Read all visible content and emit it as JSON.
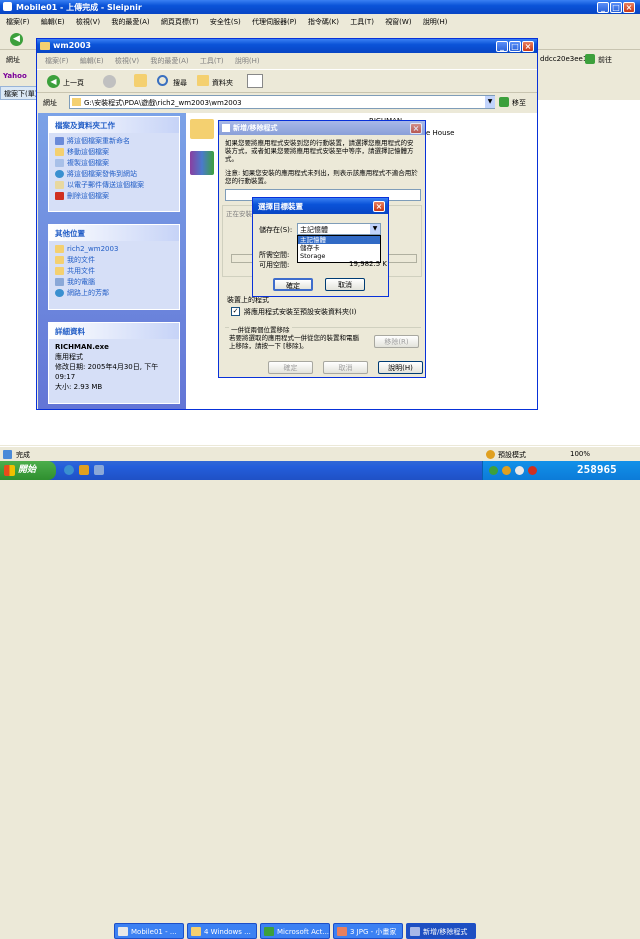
{
  "browser": {
    "title": "Mobile01 - 上傳完成 - Sleipnir",
    "menu": [
      "檔案(F)",
      "編輯(E)",
      "檢視(V)",
      "我的最愛(A)",
      "網頁頁標(T)",
      "安全性(S)",
      "代理伺服器(P)",
      "指令碼(K)",
      "工具(T)",
      "視窗(W)",
      "說明(H)"
    ],
    "url_fragment": "ddcc20e3ee17",
    "go_label": "前往",
    "address_label": "網址",
    "fav_label": "Yahoo",
    "status_text": "完成",
    "status_mode": "預設模式",
    "zoom": "100%",
    "tab_label": "檔案下(單)"
  },
  "explorer": {
    "title": "wm2003",
    "menu": [
      "檔案(F)",
      "編輯(E)",
      "檢視(V)",
      "我的最愛(A)",
      "工具(T)",
      "說明(H)"
    ],
    "back_label": "上一頁",
    "search_label": "搜尋",
    "folders_label": "資料夾",
    "address_label": "網址",
    "address": "G:\\安裝程式\\PDA\\遊戲\\rich2_wm2003\\wm2003",
    "go_label": "移至",
    "file_tasks": {
      "title": "檔案及資料夾工作",
      "items": [
        "將這個檔案重新命名",
        "移動這個檔案",
        "複製這個檔案",
        "將這個檔案發佈到網站",
        "以電子郵件傳送這個檔案",
        "刪除這個檔案"
      ]
    },
    "other_places": {
      "title": "其他位置",
      "items": [
        "rich2_wm2003",
        "我的文件",
        "共用文件",
        "我的電腦",
        "網路上的芳鄰"
      ]
    },
    "details": {
      "title": "詳細資料",
      "name": "RICHMAN.exe",
      "type": "應用程式",
      "modified": "修改日期: 2005年4月30日, 下午 09:17",
      "size": "大小: 2.93 MB"
    },
    "file_label_1": "RICHMAN",
    "file_label_2": "e House"
  },
  "install_dialog": {
    "title": "新增/移除程式",
    "text1": "如果您要將應用程式安裝到您的行動裝置，請選擇您應用程式的安裝方式，或者如果您要將應用程式安裝至中等序，請選擇記憶體方式。",
    "text2": "注意: 如果您安裝的應用程式未列出，則表示該應用程式不適合用於您的行動裝置。",
    "progress_label": "正在安裝",
    "device_label": "裝置上的程式",
    "checkbox_label": "將應用程式安裝至預設安裝資料夾(I)",
    "remove_section": "一併從兩個位置移除",
    "remove_text": "若要將選取的應用程式一併從您的裝置和電腦上移除，請按一下 [移除]。",
    "remove_btn": "移除(R)",
    "ok_btn": "確定",
    "cancel_btn": "取消",
    "help_btn": "說明(H)"
  },
  "select_dialog": {
    "title": "選擇目標裝置",
    "save_label": "儲存在(S):",
    "selected": "主記憶體",
    "options": [
      "主記憶體",
      "儲存卡",
      "Storage"
    ],
    "required_label": "所需空間:",
    "available_label": "可用空間:",
    "available_value": "19,982.5 K",
    "ok_btn": "確定",
    "cancel_btn": "取消"
  },
  "taskbar": {
    "start": "開始",
    "tasks": [
      "Mobile01 - ...",
      "4 Windows ...",
      "Microsoft Act...",
      "3 JPG - 小畫家",
      "新增/移除程式"
    ],
    "tray": "258965"
  }
}
